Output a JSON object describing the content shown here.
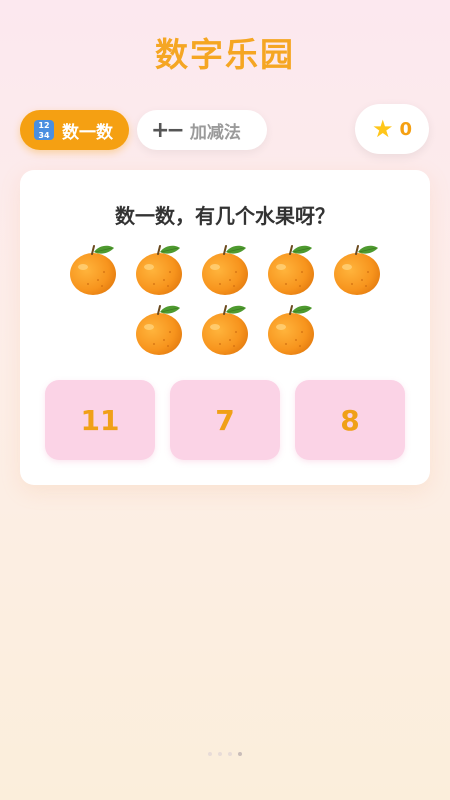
{
  "app": {
    "title": "数字乐园"
  },
  "tabs": [
    {
      "label": "数一数",
      "icon": "number-grid-icon",
      "active": true
    },
    {
      "label": "加减法",
      "icon": "plus-minus-icon",
      "active": false
    }
  ],
  "score": {
    "icon": "star-icon",
    "value": "0"
  },
  "question": {
    "text": "数一数，有几个水果呀？",
    "fruit_icon": "orange-icon",
    "fruit_count": 8
  },
  "answers": [
    "11",
    "7",
    "8"
  ],
  "pager": {
    "pages": 4,
    "active": 3
  },
  "colors": {
    "accent": "#f5a012",
    "answer_bg": "#fbd3e6",
    "fruit": "#f7941d"
  }
}
